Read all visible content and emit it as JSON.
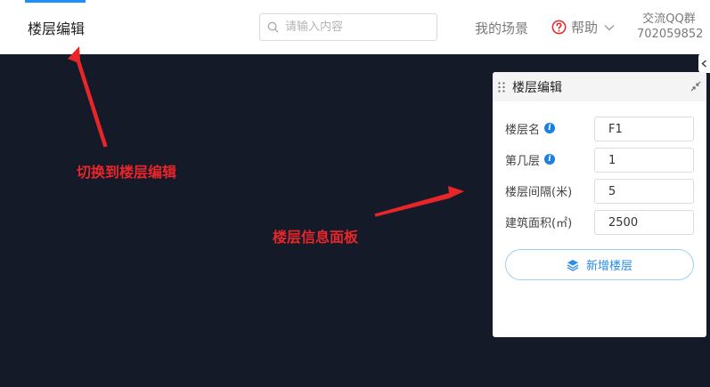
{
  "header": {
    "title": "楼层编辑",
    "search_placeholder": "请输入内容",
    "my_scenes": "我的场景",
    "help": "帮助",
    "qq_group_label": "交流QQ群",
    "qq_group_number": "702059852"
  },
  "panel": {
    "title": "楼层编辑",
    "fields": [
      {
        "label": "楼层名",
        "value": "F1",
        "has_info": true
      },
      {
        "label": "第几层",
        "value": "1",
        "has_info": true
      },
      {
        "label": "楼层间隔(米)",
        "value": "5",
        "has_info": false
      },
      {
        "label": "建筑面积(㎡)",
        "value": "2500",
        "has_info": false
      }
    ],
    "add_button": "新增楼层"
  },
  "annotations": {
    "switch_hint": "切换到楼层编辑",
    "panel_hint": "楼层信息面板"
  },
  "colors": {
    "canvas_bg": "#141a27",
    "accent": "#1e8fff",
    "annotation": "#e8262a",
    "help_icon": "#e8262a",
    "info_icon": "#1b7fe0"
  },
  "icons": {
    "search": "search-icon",
    "help": "question-circle-icon",
    "chevron": "chevron-down-icon",
    "drag": "drag-handle-icon",
    "collapse": "collapse-icon",
    "add_floor": "layers-icon"
  }
}
